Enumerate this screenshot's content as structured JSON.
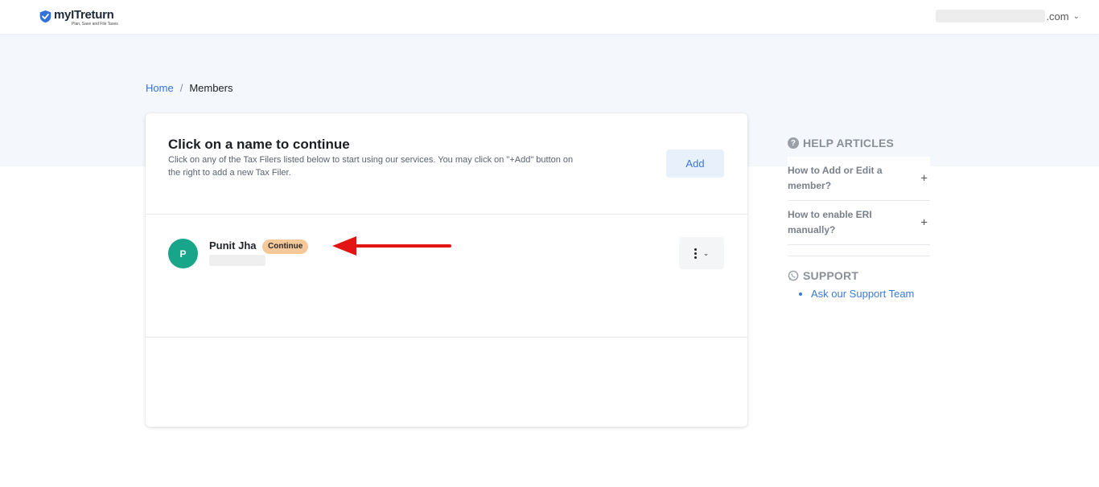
{
  "brand": {
    "name": "myITreturn",
    "tagline": "Plan, Save and File Taxes",
    "accent": "#3272d9"
  },
  "header": {
    "user_email_suffix": ".com",
    "user_menu_icon": "chevron-down-icon"
  },
  "breadcrumb": {
    "home": "Home",
    "separator": "/",
    "current": "Members"
  },
  "members_card": {
    "title": "Click on a name to continue",
    "description": "Click on any of the Tax Filers listed below to start using our services. You may click on \"+Add\" button on the right to add a new Tax Filer.",
    "add_button": "Add",
    "members": [
      {
        "initial": "P",
        "name": "Punit Jha",
        "badge": "Continue",
        "avatar_color": "#17a68a"
      }
    ]
  },
  "help": {
    "title": "HELP ARTICLES",
    "icon": "question-circle-icon",
    "articles": [
      {
        "label": "How to Add or Edit a member?",
        "toggle": "+"
      },
      {
        "label": "How to enable ERI manually?",
        "toggle": "+"
      }
    ]
  },
  "support": {
    "title": "SUPPORT",
    "icon": "whatsapp-icon",
    "links": [
      {
        "label": "Ask our Support Team"
      }
    ]
  },
  "annotation": {
    "arrow_color": "#e31414"
  }
}
